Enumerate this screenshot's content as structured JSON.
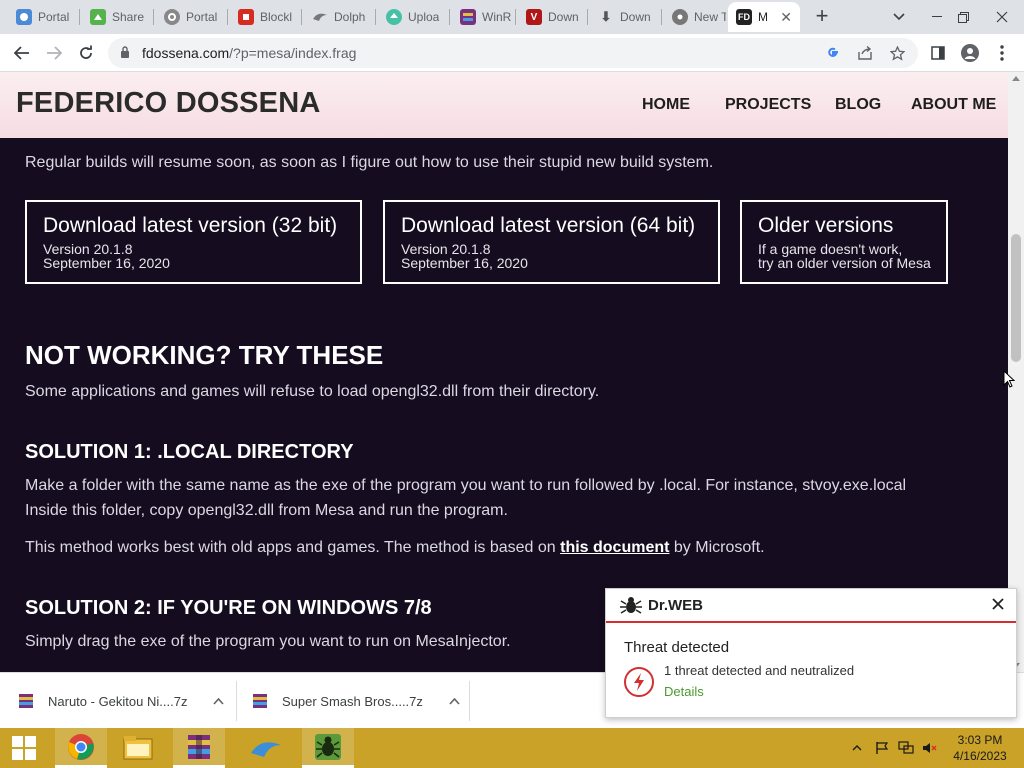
{
  "browser": {
    "tabs": [
      {
        "label": "Portal",
        "icon": "steam-icon",
        "color": "#4b8bd6"
      },
      {
        "label": "Share",
        "icon": "share-icon",
        "color": "#56b24b"
      },
      {
        "label": "Portal",
        "icon": "portal-icon",
        "color": "#888888"
      },
      {
        "label": "Blockl",
        "icon": "block-icon",
        "color": "#d62b1e"
      },
      {
        "label": "Dolph",
        "icon": "dolphin-icon",
        "color": "#777777"
      },
      {
        "label": "Uploa",
        "icon": "upload-icon",
        "color": "#46c1a8"
      },
      {
        "label": "WinR",
        "icon": "winrar-icon",
        "color": "#7a2f7f"
      },
      {
        "label": "Down",
        "icon": "v-icon",
        "color": "#b01818"
      },
      {
        "label": "Down",
        "icon": "download-icon",
        "color": "#555555"
      },
      {
        "label": "New T",
        "icon": "chrome-icon",
        "color": "#777777"
      },
      {
        "label": "M",
        "icon": "fd-icon",
        "color": "#222222",
        "active": true
      }
    ],
    "url_domain": "fdossena.com",
    "url_path": "/?p=mesa/index.frag"
  },
  "site": {
    "title": "FEDERICO DOSSENA",
    "nav": [
      "HOME",
      "PROJECTS",
      "BLOG",
      "ABOUT ME"
    ]
  },
  "content": {
    "notice": "Regular builds will resume soon, as soon as I figure out how to use their stupid new build system.",
    "downloads": [
      {
        "title": "Download latest version (32 bit)",
        "line1": "Version 20.1.8",
        "line2": "September 16, 2020"
      },
      {
        "title": "Download latest version (64 bit)",
        "line1": "Version 20.1.8",
        "line2": "September 16, 2020"
      },
      {
        "title": "Older versions",
        "line1": "If a game doesn't work,",
        "line2": "try an older version of Mesa"
      }
    ],
    "heading_main": "NOT WORKING? TRY THESE",
    "intro": "Some applications and games will refuse to load opengl32.dll from their directory.",
    "solution1_heading": "SOLUTION 1: .LOCAL DIRECTORY",
    "solution1_p1": "Make a folder with the same name as the exe of the program you want to run followed by .local. For instance, stvoy.exe.local",
    "solution1_p2": "Inside this folder, copy opengl32.dll from Mesa and run the program.",
    "solution1_p3_before": "This method works best with old apps and games. The method is based on ",
    "solution1_p3_link": "this document",
    "solution1_p3_after": " by Microsoft.",
    "solution2_heading": "SOLUTION 2: IF YOU'RE ON WINDOWS 7/8",
    "solution2_p1": "Simply drag the exe of the program you want to run on MesaInjector."
  },
  "downloads_shelf": [
    {
      "name": "Naruto - Gekitou Ni....7z"
    },
    {
      "name": "Super Smash Bros.....7z"
    }
  ],
  "drweb": {
    "brand": "Dr.WEB",
    "title": "Threat detected",
    "message": "1 threat detected and neutralized",
    "details": "Details"
  },
  "taskbar": {
    "time": "3:03 PM",
    "date": "4/16/2023"
  }
}
